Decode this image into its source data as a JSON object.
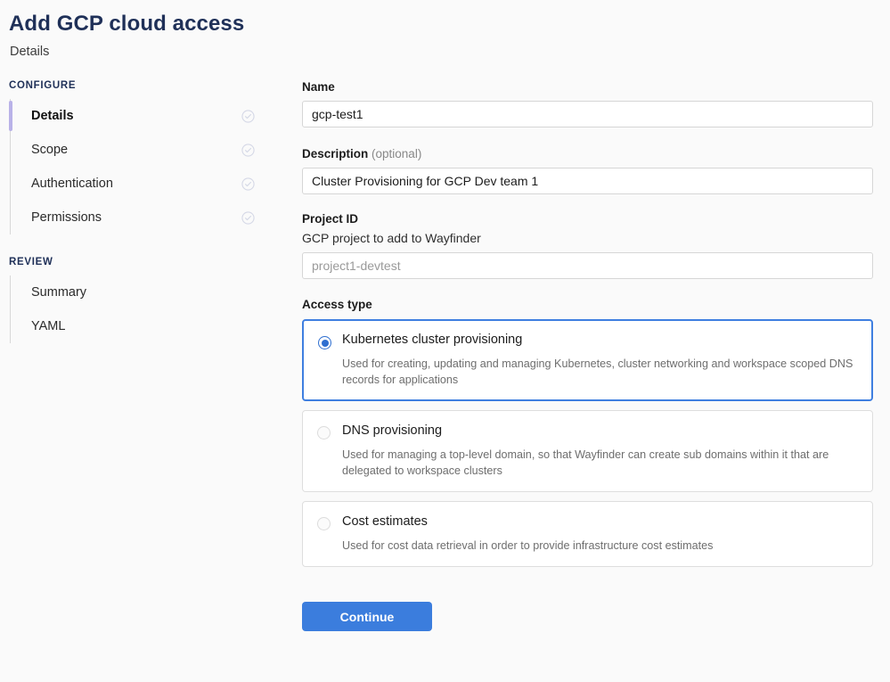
{
  "header": {
    "title": "Add GCP cloud access",
    "subtitle": "Details"
  },
  "sidebar": {
    "configure_heading": "CONFIGURE",
    "review_heading": "REVIEW",
    "configure_items": [
      {
        "label": "Details",
        "icon": "check-circle-icon"
      },
      {
        "label": "Scope",
        "icon": "check-circle-icon"
      },
      {
        "label": "Authentication",
        "icon": "check-circle-icon"
      },
      {
        "label": "Permissions",
        "icon": "check-circle-icon"
      }
    ],
    "review_items": [
      {
        "label": "Summary"
      },
      {
        "label": "YAML"
      }
    ],
    "active_item": "Details",
    "active_indicator_color": "#b9b2e8"
  },
  "form": {
    "name": {
      "label": "Name",
      "value": "gcp-test1",
      "placeholder": ""
    },
    "description": {
      "label": "Description",
      "optional_text": "(optional)",
      "value": "Cluster Provisioning for GCP Dev team 1",
      "placeholder": ""
    },
    "project_id": {
      "label": "Project ID",
      "sublabel": "GCP project to add to Wayfinder",
      "value": "",
      "placeholder": "project1-devtest"
    },
    "access_type": {
      "label": "Access type",
      "selected": "Kubernetes cluster provisioning",
      "options": [
        {
          "title": "Kubernetes cluster provisioning",
          "description": "Used for creating, updating and managing Kubernetes, cluster networking and workspace scoped DNS records for applications",
          "selected": true
        },
        {
          "title": "DNS provisioning",
          "description": "Used for managing a top-level domain, so that Wayfinder can create sub domains within it that are delegated to workspace clusters",
          "selected": false
        },
        {
          "title": "Cost estimates",
          "description": "Used for cost data retrieval in order to provide infrastructure cost estimates",
          "selected": false
        }
      ]
    },
    "continue_label": "Continue"
  },
  "colors": {
    "accent_blue": "#3b7ddd",
    "radio_blue": "#2f6fd0",
    "selected_border": "#3f7fe0",
    "title_navy": "#1f3058",
    "page_background": "#fafafa"
  }
}
